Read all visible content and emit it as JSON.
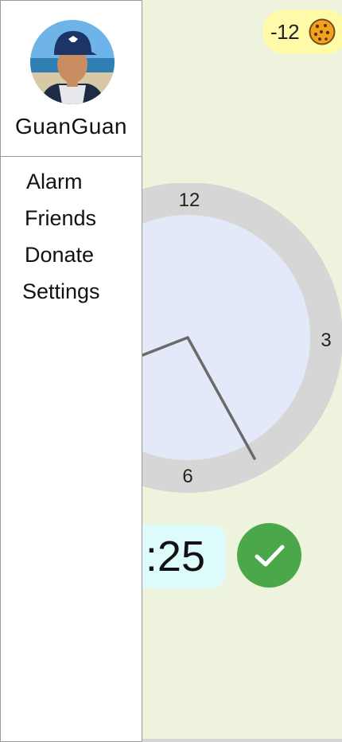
{
  "user": {
    "name": "GuanGuan"
  },
  "menu": {
    "items": [
      {
        "label": "Alarm"
      },
      {
        "label": "Friends"
      },
      {
        "label": "Donate"
      },
      {
        "label": "Settings"
      }
    ]
  },
  "coins": {
    "count": "-12",
    "icon": "cookie-icon"
  },
  "clock": {
    "labels": {
      "twelve": "12",
      "three": "3",
      "six": "6"
    }
  },
  "time": {
    "visible_text": ":25"
  },
  "colors": {
    "background": "#eef3dd",
    "coin_badge": "#fffaa8",
    "clock_face": "#e3e9f8",
    "clock_ring": "#d6d6d6",
    "time_pill": "#ddfbfb",
    "confirm": "#4aa84a"
  }
}
